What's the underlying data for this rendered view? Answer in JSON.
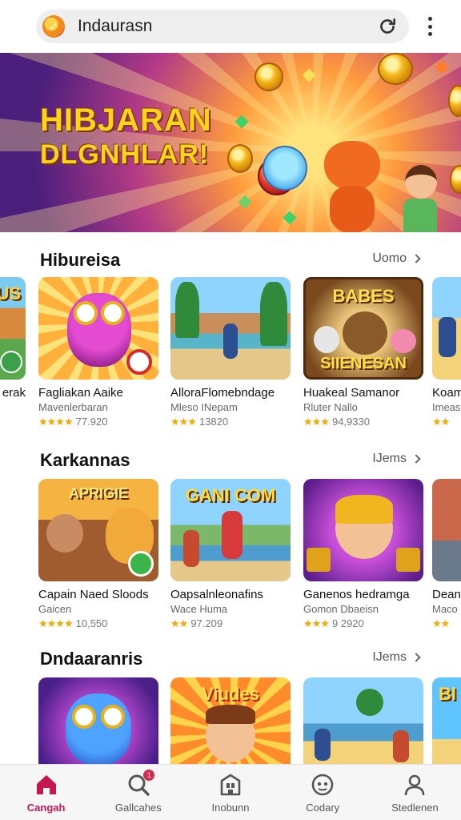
{
  "browser": {
    "url_text": "Indaurasn"
  },
  "hero": {
    "line1": "HIBJARAN",
    "line2": "DLGNHLAR!"
  },
  "sections": [
    {
      "title": "Hibureisa",
      "see_more": "Uomo",
      "items": [
        {
          "name": "erak",
          "dev": "",
          "rating": "",
          "thumb_label": "US"
        },
        {
          "name": "Fagliakan Aaike",
          "dev": "Mavenlerbaran",
          "rating": "77.920",
          "stars": "★★★★",
          "thumb_label": ""
        },
        {
          "name": "AlloraFlomebndage",
          "dev": "Mleso INepam",
          "rating": "13820",
          "stars": "★★★",
          "thumb_label": ""
        },
        {
          "name": "Huakeal Samanor",
          "dev": "Rluter Nallo",
          "rating": "94,9330",
          "stars": "★★★",
          "thumb_label": "BABES"
        },
        {
          "name": "Koam",
          "dev": "Imeas",
          "rating": "",
          "stars": "★★",
          "thumb_label": ""
        }
      ],
      "thumb_sublabel_4": "SIIENESAN"
    },
    {
      "title": "Karkannas",
      "see_more": "IJems",
      "items": [
        {
          "name": "Capain Naed Sloods",
          "dev": "Gaicen",
          "rating": "10,550",
          "stars": "★★★★",
          "thumb_label": "APRIGIE"
        },
        {
          "name": "Oapsalnleonafins",
          "dev": "Wace Huma",
          "rating": "97.209",
          "stars": "★★",
          "thumb_label": "GANI COM"
        },
        {
          "name": "Ganenos hedramga",
          "dev": "Gomon Dbaeisn",
          "rating": "9 2920",
          "stars": "★★★",
          "thumb_label": ""
        },
        {
          "name": "Dean",
          "dev": "Maco",
          "rating": "",
          "stars": "★★",
          "thumb_label": ""
        }
      ]
    },
    {
      "title": "Dndaaranris",
      "see_more": "IJems",
      "items": [
        {
          "name": "",
          "dev": "",
          "rating": "",
          "thumb_label": ""
        },
        {
          "name": "",
          "dev": "",
          "rating": "",
          "thumb_label": "Viudes"
        },
        {
          "name": "",
          "dev": "",
          "rating": "",
          "thumb_label": ""
        },
        {
          "name": "",
          "dev": "",
          "rating": "",
          "thumb_label": "Bl"
        }
      ]
    }
  ],
  "bottom_nav": [
    {
      "label": "Cangah",
      "icon": "home-icon",
      "active": true
    },
    {
      "label": "Gallcahes",
      "icon": "search-icon",
      "badge": "1"
    },
    {
      "label": "Inobunn",
      "icon": "building-icon"
    },
    {
      "label": "Codary",
      "icon": "gamepad-icon"
    },
    {
      "label": "Stedlenen",
      "icon": "profile-icon"
    }
  ],
  "colors": {
    "accent": "#c4174e",
    "star": "#f2a900"
  }
}
